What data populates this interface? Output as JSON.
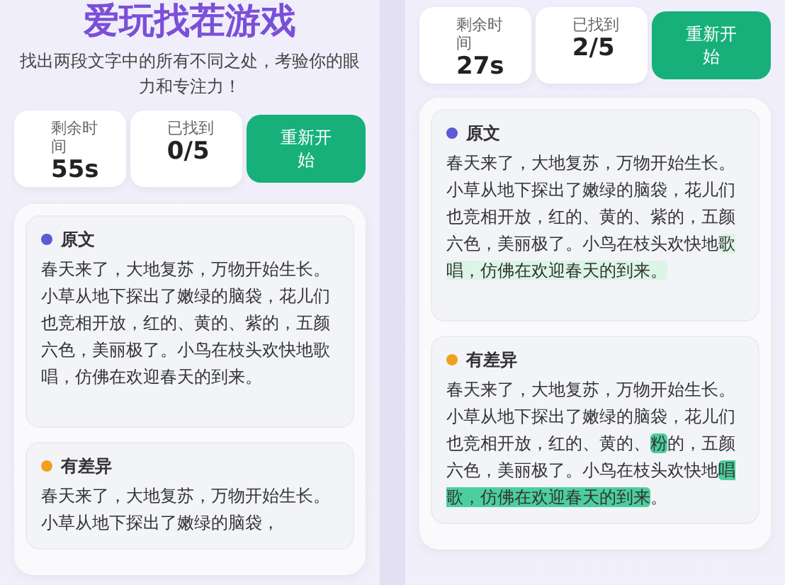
{
  "screens": [
    {
      "title": "爱玩找茬游戏",
      "subtitle": "找出两段文字中的所有不同之处，考验你的眼力和专注力！",
      "stats": [
        {
          "label": "剩余时间",
          "value": "55s"
        },
        {
          "label": "已找到",
          "value": "0/5"
        }
      ],
      "restart_button": "重新开始",
      "passages": [
        {
          "kind": "original",
          "label": "原文",
          "color": "#5b5bd6",
          "segments": [
            {
              "text": "春天来了，大地复苏，万物开始生长。小草从地下探出了嫩绿的脑袋，花儿们也竞相开放，红的、黄的、紫的，五颜六色，美丽极了。小鸟在枝头欢快地歌唱，仿佛在欢迎春天的到来。",
              "highlighted": false
            }
          ]
        },
        {
          "kind": "variant",
          "label": "有差异",
          "color": "#f0a020",
          "segments": [
            {
              "text": "春天来了，大地复苏，万物开始生长。小草从地下探出了嫩绿的脑袋，",
              "highlighted": false
            }
          ]
        }
      ]
    },
    {
      "stats": [
        {
          "label": "剩余时间",
          "value": "27s"
        },
        {
          "label": "已找到",
          "value": "2/5"
        }
      ],
      "restart_button": "重新开始",
      "passages": [
        {
          "kind": "original",
          "label": "原文",
          "color": "#5b5bd6",
          "segments": [
            {
              "text": "春天来了，大地复苏，万物开始生长。小草从地下探出了嫩绿的脑袋，花儿们也竞相开放，红的、黄的、紫的，五颜六色，美丽极了。小鸟在枝头欢快地",
              "highlighted": false
            },
            {
              "text": "歌唱，仿佛在欢迎春天的到来。",
              "highlighted": true
            }
          ]
        },
        {
          "kind": "variant",
          "label": "有差异",
          "color": "#f0a020",
          "segments": [
            {
              "text": "春天来了，大地复苏，万物开始生长。小草从地下探出了嫩绿的脑袋，花儿们也竞相开放，红的、黄的、",
              "highlighted": false
            },
            {
              "text": "粉",
              "highlighted": true
            },
            {
              "text": "的，五颜六色，美丽极了。小鸟在枝头欢快地",
              "highlighted": false
            },
            {
              "text": "唱歌，仿佛在欢迎春天的到来",
              "highlighted": true
            },
            {
              "text": "。",
              "highlighted": false
            }
          ]
        }
      ]
    }
  ]
}
